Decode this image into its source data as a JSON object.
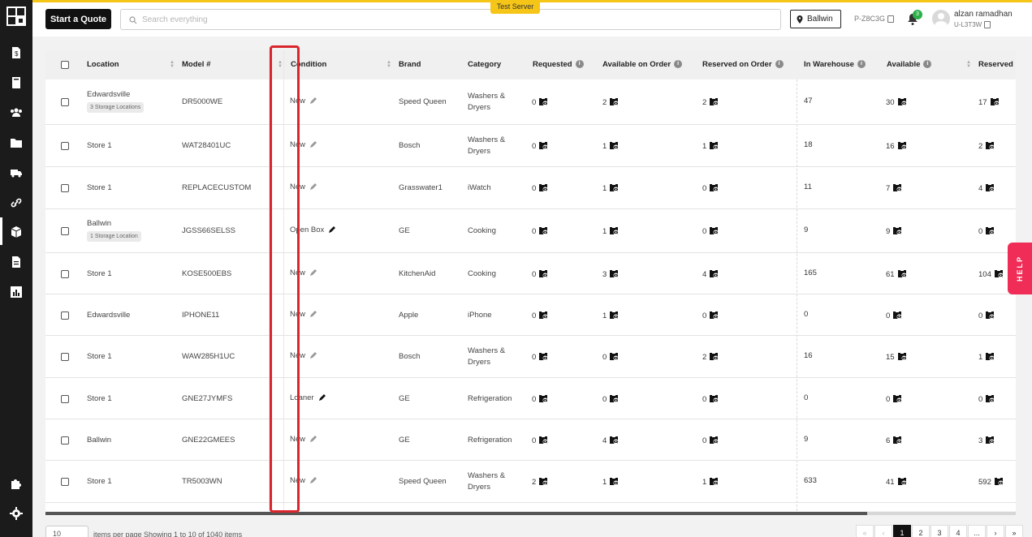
{
  "header": {
    "quote_button": "Start a Quote",
    "search_placeholder": "Search everything",
    "test_badge": "Test Server",
    "location": "Ballwin",
    "p_code": "P-Z8C3G",
    "notifications": "3",
    "user_name": "alzan ramadhan",
    "user_id": "U-L3T3W"
  },
  "table": {
    "columns": [
      "Location",
      "Model #",
      "Condition",
      "Brand",
      "Category",
      "Requested",
      "Available on Order",
      "Reserved on Order",
      "In Warehouse",
      "Available",
      "Reserved"
    ],
    "rows": [
      {
        "location": "Edwardsville",
        "badge": "3 Storage Locations",
        "model": "DR5000WE",
        "condition": "New",
        "brand": "Speed Queen",
        "category": "Washers & Dryers",
        "requested": "0",
        "avail_order": "2",
        "res_order": "2",
        "warehouse": "47",
        "available": "30",
        "reserved": "17"
      },
      {
        "location": "Store 1",
        "badge": "",
        "model": "WAT28401UC",
        "condition": "New",
        "brand": "Bosch",
        "category": "Washers & Dryers",
        "requested": "0",
        "avail_order": "1",
        "res_order": "1",
        "warehouse": "18",
        "available": "16",
        "reserved": "2"
      },
      {
        "location": "Store 1",
        "badge": "",
        "model": "REPLACECUSTOM",
        "condition": "New",
        "brand": "Grasswater1",
        "category": "iWatch",
        "requested": "0",
        "avail_order": "1",
        "res_order": "0",
        "warehouse": "11",
        "available": "7",
        "reserved": "4"
      },
      {
        "location": "Ballwin",
        "badge": "1 Storage Location",
        "model": "JGSS66SELSS",
        "condition": "Open Box",
        "brand": "GE",
        "category": "Cooking",
        "requested": "0",
        "avail_order": "1",
        "res_order": "0",
        "warehouse": "9",
        "available": "9",
        "reserved": "0"
      },
      {
        "location": "Store 1",
        "badge": "",
        "model": "KOSE500EBS",
        "condition": "New",
        "brand": "KitchenAid",
        "category": "Cooking",
        "requested": "0",
        "avail_order": "3",
        "res_order": "4",
        "warehouse": "165",
        "available": "61",
        "reserved": "104"
      },
      {
        "location": "Edwardsville",
        "badge": "",
        "model": "IPHONE11",
        "condition": "New",
        "brand": "Apple",
        "category": "iPhone",
        "requested": "0",
        "avail_order": "1",
        "res_order": "0",
        "warehouse": "0",
        "available": "0",
        "reserved": "0"
      },
      {
        "location": "Store 1",
        "badge": "",
        "model": "WAW285H1UC",
        "condition": "New",
        "brand": "Bosch",
        "category": "Washers & Dryers",
        "requested": "0",
        "avail_order": "0",
        "res_order": "2",
        "warehouse": "16",
        "available": "15",
        "reserved": "1"
      },
      {
        "location": "Store 1",
        "badge": "",
        "model": "GNE27JYMFS",
        "condition": "Loaner",
        "brand": "GE",
        "category": "Refrigeration",
        "requested": "0",
        "avail_order": "0",
        "res_order": "0",
        "warehouse": "0",
        "available": "0",
        "reserved": "0"
      },
      {
        "location": "Ballwin",
        "badge": "",
        "model": "GNE22GMEES",
        "condition": "New",
        "brand": "GE",
        "category": "Refrigeration",
        "requested": "0",
        "avail_order": "4",
        "res_order": "0",
        "warehouse": "9",
        "available": "6",
        "reserved": "3"
      },
      {
        "location": "Store 1",
        "badge": "",
        "model": "TR5003WN",
        "condition": "New",
        "brand": "Speed Queen",
        "category": "Washers & Dryers",
        "requested": "2",
        "avail_order": "1",
        "res_order": "1",
        "warehouse": "633",
        "available": "41",
        "reserved": "592"
      }
    ]
  },
  "footer": {
    "per_page": "10",
    "items_text": "items per page    Showing 1 to 10 of 1040 items",
    "pages": [
      "«",
      "‹",
      "1",
      "2",
      "3",
      "4",
      "...",
      "›",
      "»"
    ]
  },
  "help": "HELP",
  "colors": {
    "accent": "#f5c518",
    "highlight": "#d9262c",
    "help": "#ef2d56"
  }
}
